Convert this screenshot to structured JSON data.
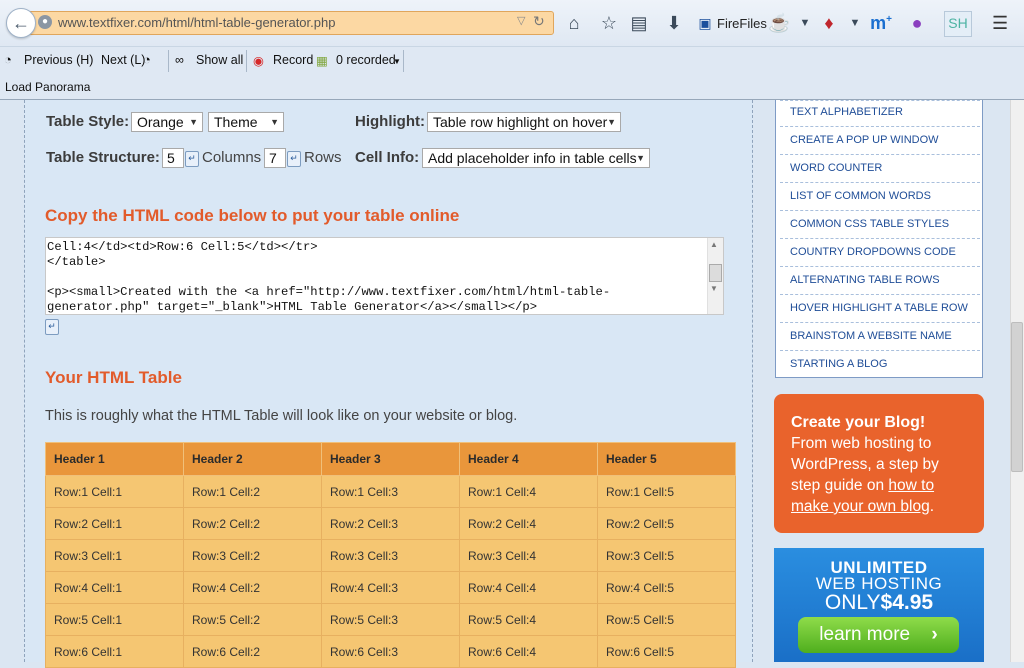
{
  "browser": {
    "url": "www.textfixer.com/html/html-table-generator.php",
    "firefiles_label": "FireFiles"
  },
  "recorder_toolbar": {
    "previous_label": "Previous (H)",
    "next_label": "Next (L)",
    "show_all_label": "Show all",
    "record_label": "Record",
    "recorded_label": "0 recorded"
  },
  "bookmarks": {
    "item": "Load Panorama"
  },
  "controls": {
    "table_style_label": "Table Style:",
    "style_value": "Orange",
    "theme_value": "Theme",
    "highlight_label": "Highlight:",
    "highlight_value": "Table row highlight on hover",
    "table_structure_label": "Table Structure:",
    "columns_value": "5",
    "columns_label": "Columns",
    "rows_value": "7",
    "rows_label": "Rows",
    "cell_info_label": "Cell Info:",
    "cell_info_value": "Add placeholder info in table cells"
  },
  "code_section": {
    "title": "Copy the HTML code below to put your table online",
    "code": "Cell:4</td><td>Row:6 Cell:5</td></tr>\n</table>\n\n<p><small>Created with the <a href=\"http://www.textfixer.com/html/html-table-\ngenerator.php\" target=\"_blank\">HTML Table Generator</a></small></p>"
  },
  "table_section": {
    "title": "Your HTML Table",
    "description": "This is roughly what the HTML Table will look like on your website or blog.",
    "headers": [
      "Header 1",
      "Header 2",
      "Header 3",
      "Header 4",
      "Header 5"
    ],
    "rows": [
      [
        "Row:1 Cell:1",
        "Row:1 Cell:2",
        "Row:1 Cell:3",
        "Row:1 Cell:4",
        "Row:1 Cell:5"
      ],
      [
        "Row:2 Cell:1",
        "Row:2 Cell:2",
        "Row:2 Cell:3",
        "Row:2 Cell:4",
        "Row:2 Cell:5"
      ],
      [
        "Row:3 Cell:1",
        "Row:3 Cell:2",
        "Row:3 Cell:3",
        "Row:3 Cell:4",
        "Row:3 Cell:5"
      ],
      [
        "Row:4 Cell:1",
        "Row:4 Cell:2",
        "Row:4 Cell:3",
        "Row:4 Cell:4",
        "Row:4 Cell:5"
      ],
      [
        "Row:5 Cell:1",
        "Row:5 Cell:2",
        "Row:5 Cell:3",
        "Row:5 Cell:4",
        "Row:5 Cell:5"
      ],
      [
        "Row:6 Cell:1",
        "Row:6 Cell:2",
        "Row:6 Cell:3",
        "Row:6 Cell:4",
        "Row:6 Cell:5"
      ]
    ]
  },
  "sidebar": {
    "links": [
      "TEXT ALPHABETIZER",
      "CREATE A POP UP WINDOW",
      "WORD COUNTER",
      "LIST OF COMMON WORDS",
      "COMMON CSS TABLE STYLES",
      "COUNTRY DROPDOWNS CODE",
      "ALTERNATING TABLE ROWS",
      "HOVER HIGHLIGHT A TABLE ROW",
      "BRAINSTOM A WEBSITE NAME",
      "STARTING A BLOG"
    ],
    "promo_title": "Create your Blog!",
    "promo_text": "From web hosting to WordPress, a step by step guide on",
    "promo_link": "how to make your own blog",
    "promo_end": ".",
    "ad_line1": "UNLIMITED",
    "ad_line2": "WEB HOSTING",
    "ad_line3_prefix": "ONLY",
    "ad_price": "$4.95",
    "ad_button": "learn more",
    "ad_button_arrow": "›"
  },
  "colors": {
    "accent_orange": "#e25b2b",
    "table_header": "#e9963b",
    "table_cell": "#f5c672",
    "link_blue": "#1f4d97"
  }
}
